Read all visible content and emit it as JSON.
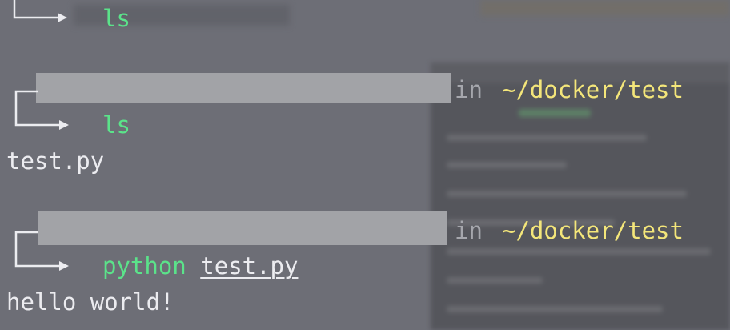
{
  "terminal": {
    "line1": {
      "command": "ls"
    },
    "block2": {
      "in_word": "in",
      "path": "~/docker/test",
      "command": "ls",
      "output": "test.py"
    },
    "block3": {
      "in_word": "in",
      "path": "~/docker/test",
      "command": "python",
      "argument": "test.py",
      "output": "hello world!"
    }
  },
  "icons": {
    "prompt_arrow": "return-arrow-icon"
  },
  "colors": {
    "background": "#6d6e76",
    "command": "#5be38a",
    "path": "#f4e67a",
    "text": "#ececf0",
    "redaction": "#a2a3a7"
  }
}
